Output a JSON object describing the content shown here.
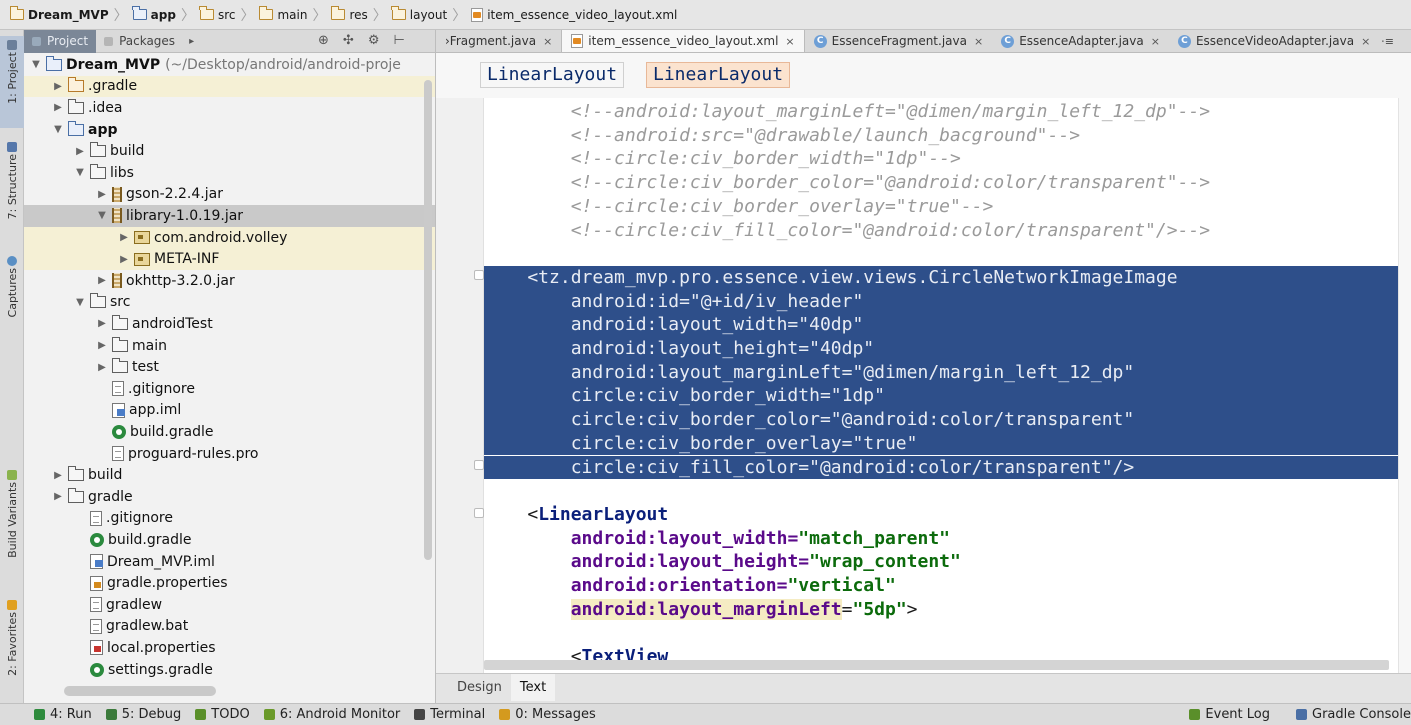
{
  "navbar": {
    "crumbs": [
      {
        "label": "Dream_MVP",
        "bold": true,
        "icon": "folder"
      },
      {
        "label": "app",
        "bold": true,
        "icon": "module-folder"
      },
      {
        "label": "src",
        "bold": false,
        "icon": "folder"
      },
      {
        "label": "main",
        "bold": false,
        "icon": "folder"
      },
      {
        "label": "res",
        "bold": false,
        "icon": "folder"
      },
      {
        "label": "layout",
        "bold": false,
        "icon": "folder"
      },
      {
        "label": "item_essence_video_layout.xml",
        "bold": false,
        "icon": "xml-file"
      }
    ]
  },
  "left_strip": {
    "tabs": [
      "1: Project",
      "7: Structure",
      "Captures",
      "Build Variants",
      "2: Favorites"
    ]
  },
  "project_panel": {
    "tabs": [
      "Project",
      "Packages"
    ],
    "tree": [
      {
        "label": "Dream_MVP",
        "path": "(~/Desktop/android/android-proje",
        "depth": 0,
        "arrow": "down",
        "icon": "folder-mod",
        "bold": true
      },
      {
        "label": ".gradle",
        "depth": 1,
        "arrow": "right",
        "icon": "folder-y",
        "hl": true
      },
      {
        "label": ".idea",
        "depth": 1,
        "arrow": "right",
        "icon": "folder"
      },
      {
        "label": "app",
        "depth": 1,
        "arrow": "down",
        "icon": "folder-mod",
        "bold": true
      },
      {
        "label": "build",
        "depth": 2,
        "arrow": "right",
        "icon": "folder"
      },
      {
        "label": "libs",
        "depth": 2,
        "arrow": "down",
        "icon": "folder"
      },
      {
        "label": "gson-2.2.4.jar",
        "depth": 3,
        "arrow": "right",
        "icon": "jar"
      },
      {
        "label": "library-1.0.19.jar",
        "depth": 3,
        "arrow": "down",
        "icon": "jar",
        "sel": true
      },
      {
        "label": "com.android.volley",
        "depth": 4,
        "arrow": "right",
        "icon": "pkg",
        "hl": true
      },
      {
        "label": "META-INF",
        "depth": 4,
        "arrow": "right",
        "icon": "pkg",
        "hl": true
      },
      {
        "label": "okhttp-3.2.0.jar",
        "depth": 3,
        "arrow": "right",
        "icon": "jar"
      },
      {
        "label": "src",
        "depth": 2,
        "arrow": "down",
        "icon": "folder"
      },
      {
        "label": "androidTest",
        "depth": 3,
        "arrow": "right",
        "icon": "folder"
      },
      {
        "label": "main",
        "depth": 3,
        "arrow": "right",
        "icon": "folder"
      },
      {
        "label": "test",
        "depth": 3,
        "arrow": "right",
        "icon": "folder"
      },
      {
        "label": ".gitignore",
        "depth": 3,
        "arrow": "",
        "icon": "file"
      },
      {
        "label": "app.iml",
        "depth": 3,
        "arrow": "",
        "icon": "iml"
      },
      {
        "label": "build.gradle",
        "depth": 3,
        "arrow": "",
        "icon": "gradle"
      },
      {
        "label": "proguard-rules.pro",
        "depth": 3,
        "arrow": "",
        "icon": "file"
      },
      {
        "label": "build",
        "depth": 1,
        "arrow": "right",
        "icon": "folder"
      },
      {
        "label": "gradle",
        "depth": 1,
        "arrow": "right",
        "icon": "folder"
      },
      {
        "label": ".gitignore",
        "depth": 2,
        "arrow": "",
        "icon": "file"
      },
      {
        "label": "build.gradle",
        "depth": 2,
        "arrow": "",
        "icon": "gradle"
      },
      {
        "label": "Dream_MVP.iml",
        "depth": 2,
        "arrow": "",
        "icon": "iml"
      },
      {
        "label": "gradle.properties",
        "depth": 2,
        "arrow": "",
        "icon": "props"
      },
      {
        "label": "gradlew",
        "depth": 2,
        "arrow": "",
        "icon": "file"
      },
      {
        "label": "gradlew.bat",
        "depth": 2,
        "arrow": "",
        "icon": "file"
      },
      {
        "label": "local.properties",
        "depth": 2,
        "arrow": "",
        "icon": "lprops"
      },
      {
        "label": "settings.gradle",
        "depth": 2,
        "arrow": "",
        "icon": "gradle"
      }
    ]
  },
  "editor": {
    "tabs": [
      {
        "label": "›Fragment.java",
        "close": "×",
        "icon": "",
        "active": false
      },
      {
        "label": "item_essence_video_layout.xml",
        "close": "×",
        "icon": "xml",
        "active": true
      },
      {
        "label": "EssenceFragment.java",
        "close": "×",
        "icon": "C",
        "active": false
      },
      {
        "label": "EssenceAdapter.java",
        "close": "×",
        "icon": "C",
        "active": false
      },
      {
        "label": "EssenceVideoAdapter.java",
        "close": "×",
        "icon": "C",
        "active": false
      }
    ],
    "xml_breadcrumb": [
      "LinearLayout",
      "LinearLayout"
    ],
    "code_lines": [
      [
        {
          "t": "comment",
          "s": "        <!--android:layout_marginLeft=\"@dimen/margin_left_12_dp\"-->"
        }
      ],
      [
        {
          "t": "comment",
          "s": "        <!--android:src=\"@drawable/launch_bacground\"-->"
        }
      ],
      [
        {
          "t": "comment",
          "s": "        <!--circle:civ_border_width=\"1dp\"-->"
        }
      ],
      [
        {
          "t": "comment",
          "s": "        <!--circle:civ_border_color=\"@android:color/transparent\"-->"
        }
      ],
      [
        {
          "t": "comment",
          "s": "        <!--circle:civ_border_overlay=\"true\"-->"
        }
      ],
      [
        {
          "t": "comment",
          "s": "        <!--circle:civ_fill_color=\"@android:color/transparent\"/>-->"
        }
      ],
      [
        {
          "t": "plain",
          "s": ""
        }
      ],
      [
        {
          "t": "plain",
          "s": "    <tz.dream_mvp.pro.essence.view.views.CircleNetworkImageImage"
        }
      ],
      [
        {
          "t": "plain",
          "s": "        android:id=\"@+id/iv_header\""
        }
      ],
      [
        {
          "t": "plain",
          "s": "        android:layout_width=\"40dp\""
        }
      ],
      [
        {
          "t": "plain",
          "s": "        android:layout_height=\"40dp\""
        }
      ],
      [
        {
          "t": "plain",
          "s": "        android:layout_marginLeft=\"@dimen/margin_left_12_dp\""
        }
      ],
      [
        {
          "t": "plain",
          "s": "        circle:civ_border_width=\"1dp\""
        }
      ],
      [
        {
          "t": "plain",
          "s": "        circle:civ_border_color=\"@android:color/transparent\""
        }
      ],
      [
        {
          "t": "plain",
          "s": "        circle:civ_border_overlay=\"true\""
        }
      ],
      [
        {
          "t": "plain",
          "s": "        circle:civ_fill_color=\"@android:color/transparent\"/>"
        }
      ],
      [
        {
          "t": "plain",
          "s": ""
        }
      ],
      [
        {
          "t": "plain",
          "s": "    <"
        },
        {
          "t": "tag",
          "s": "LinearLayout"
        }
      ],
      [
        {
          "t": "plain",
          "s": "        "
        },
        {
          "t": "attr",
          "s": "android:layout_width="
        },
        {
          "t": "val",
          "s": "\"match_parent\""
        }
      ],
      [
        {
          "t": "plain",
          "s": "        "
        },
        {
          "t": "attr",
          "s": "android:layout_height="
        },
        {
          "t": "val",
          "s": "\"wrap_content\""
        }
      ],
      [
        {
          "t": "plain",
          "s": "        "
        },
        {
          "t": "attr",
          "s": "android:orientation="
        },
        {
          "t": "val",
          "s": "\"vertical\""
        }
      ],
      [
        {
          "t": "plain",
          "s": "        "
        },
        {
          "t": "hattr",
          "s": "android:layout_marginLeft"
        },
        {
          "t": "plain",
          "s": "="
        },
        {
          "t": "val",
          "s": "\"5dp\""
        },
        {
          "t": "plain",
          "s": ">"
        }
      ],
      [
        {
          "t": "plain",
          "s": ""
        }
      ],
      [
        {
          "t": "plain",
          "s": "        <"
        },
        {
          "t": "tag",
          "s": "TextView"
        }
      ]
    ],
    "selected_lines": [
      7,
      8,
      9,
      10,
      11,
      12,
      13,
      14,
      15
    ],
    "mode_tabs": [
      "Design",
      "Text"
    ],
    "active_mode": "Text"
  },
  "bottom_bar": {
    "tools": [
      {
        "label": "4: Run",
        "key": "4"
      },
      {
        "label": "5: Debug",
        "key": "5"
      },
      {
        "label": "TODO",
        "key": ""
      },
      {
        "label": "6: Android Monitor",
        "key": "6"
      },
      {
        "label": "Terminal",
        "key": ""
      },
      {
        "label": "0: Messages",
        "key": "0"
      }
    ],
    "right_tools": [
      "Event Log",
      "Gradle Console"
    ]
  },
  "colors": {
    "selection": "#2e4f8a",
    "tag": "#0a1f7a",
    "attr": "#5a0a8a",
    "value": "#0c6b0c",
    "comment": "#9a9a9a"
  }
}
